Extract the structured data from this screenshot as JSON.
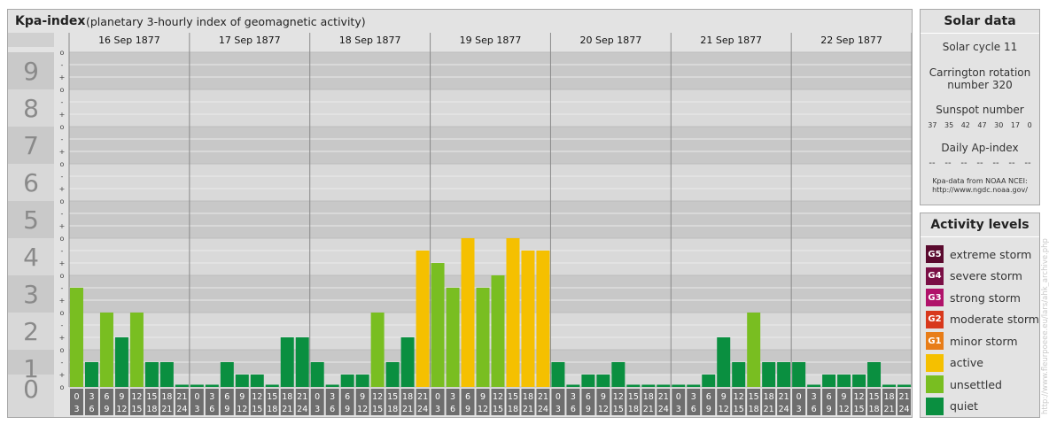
{
  "main": {
    "title": "Kpa-index",
    "subtitle": "(planetary 3-hourly index of geomagnetic activity)"
  },
  "chart_data": {
    "type": "bar",
    "title": "Kpa-index",
    "subtitle": "(planetary 3-hourly index of geomagnetic activity)",
    "ylim": [
      0,
      9
    ],
    "y_major_ticks": [
      "0",
      "1",
      "2",
      "3",
      "4",
      "5",
      "6",
      "7",
      "8",
      "9"
    ],
    "y_minor_ticks": [
      "o",
      "+",
      "-"
    ],
    "grid": true,
    "days": [
      "16 Sep 1877",
      "17 Sep 1877",
      "18 Sep 1877",
      "19 Sep 1877",
      "20 Sep 1877",
      "21 Sep 1877",
      "22 Sep 1877"
    ],
    "interval_labels": [
      [
        "0",
        "3"
      ],
      [
        "3",
        "6"
      ],
      [
        "6",
        "9"
      ],
      [
        "9",
        "12"
      ],
      [
        "12",
        "15"
      ],
      [
        "15",
        "18"
      ],
      [
        "18",
        "21"
      ],
      [
        "21",
        "24"
      ]
    ],
    "values": [
      [
        2.667,
        0.667,
        2.0,
        1.333,
        2.0,
        0.667,
        0.667,
        0.0
      ],
      [
        0.0,
        0.0,
        0.667,
        0.333,
        0.333,
        0.0,
        1.333,
        1.333
      ],
      [
        0.667,
        0.0,
        0.333,
        0.333,
        2.0,
        0.667,
        1.333,
        3.667
      ],
      [
        3.333,
        2.667,
        4.0,
        2.667,
        3.0,
        4.0,
        3.667,
        3.667
      ],
      [
        0.667,
        0.0,
        0.333,
        0.333,
        0.667,
        0.0,
        0.0,
        0.0
      ],
      [
        0.0,
        0.0,
        0.333,
        1.333,
        0.667,
        2.0,
        0.667,
        0.667
      ],
      [
        0.667,
        0.0,
        0.333,
        0.333,
        0.333,
        0.667,
        0.0,
        0.0
      ]
    ],
    "colors": {
      "quiet": "#0a8f40",
      "unsettled": "#79be21",
      "active": "#f5c000"
    }
  },
  "solar": {
    "title": "Solar data",
    "cycle": "Solar cycle 11",
    "carrington_line1": "Carrington rotation",
    "carrington_line2": "number 320",
    "sunspot_title": "Sunspot number",
    "sunspots": [
      "37",
      "35",
      "42",
      "47",
      "30",
      "17",
      "0"
    ],
    "ap_title": "Daily Ap-index",
    "ap_values": [
      "--",
      "--",
      "--",
      "--",
      "--",
      "--",
      "--"
    ],
    "source_line1": "Kpa-data from NOAA NCEI:",
    "source_line2": "http://www.ngdc.noaa.gov/"
  },
  "activity": {
    "title": "Activity levels",
    "levels": [
      {
        "code": "G5",
        "label": "extreme storm",
        "color": "#5a0a2e"
      },
      {
        "code": "G4",
        "label": "severe storm",
        "color": "#7a0f45"
      },
      {
        "code": "G3",
        "label": "strong storm",
        "color": "#b0126a"
      },
      {
        "code": "G2",
        "label": "moderate storm",
        "color": "#d8381c"
      },
      {
        "code": "G1",
        "label": "minor storm",
        "color": "#e87d18"
      },
      {
        "code": "",
        "label": "active",
        "color": "#f5c000"
      },
      {
        "code": "",
        "label": "unsettled",
        "color": "#79be21"
      },
      {
        "code": "",
        "label": "quiet",
        "color": "#0a8f40"
      }
    ]
  },
  "watermark": "http://www.fleurpoeee.eu/lars/ahk_archive.php"
}
